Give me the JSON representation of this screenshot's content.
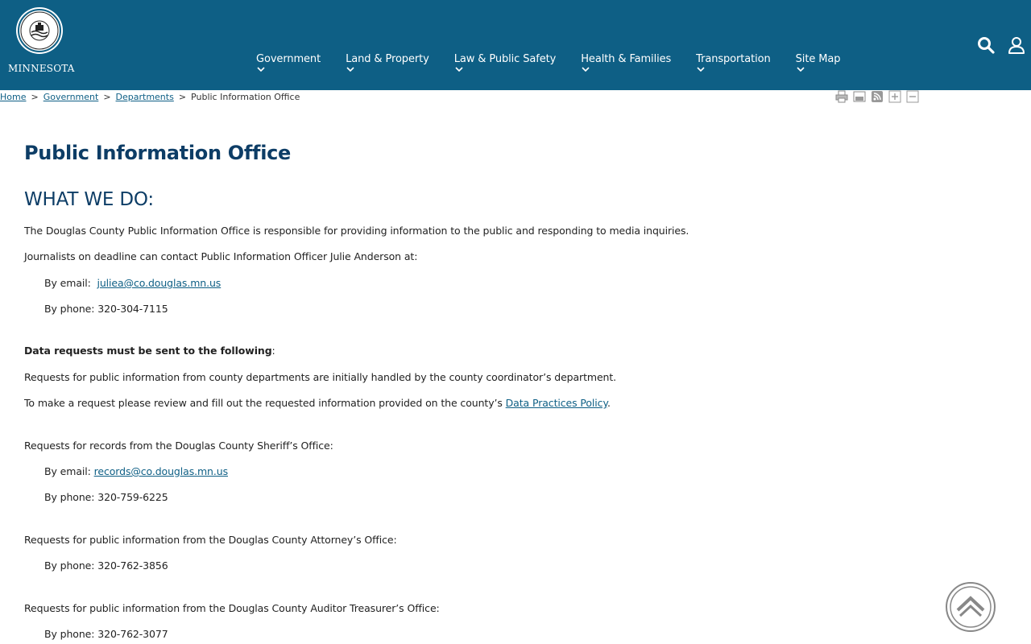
{
  "header": {
    "logo": {
      "seal_text": "DOUGLAS COUNTY",
      "state": "MINNESOTA"
    },
    "nav": [
      {
        "label": "Government"
      },
      {
        "label": "Land & Property"
      },
      {
        "label": "Law & Public Safety"
      },
      {
        "label": "Health & Families"
      },
      {
        "label": "Transportation"
      },
      {
        "label": "Site Map"
      }
    ],
    "icons": {
      "search": "search-icon",
      "account": "user-icon"
    },
    "colors": {
      "brand": "#0e5f85",
      "title": "#0d3d66"
    }
  },
  "breadcrumb": {
    "items": [
      "Home",
      "Government",
      "Departments"
    ],
    "current": "Public Information Office",
    "separator": ">"
  },
  "tools": [
    "print-icon",
    "email-icon",
    "rss-icon",
    "zoom-in-icon",
    "zoom-out-icon"
  ],
  "page": {
    "title": "Public Information Office",
    "section": "WHAT WE DO:",
    "intro": "The Douglas County Public Information Office is responsible for providing information to the public and responding to media inquiries.",
    "journalists": "Journalists on deadline can contact Public Information Officer Julie Anderson at:",
    "pio_email_label": "By email:",
    "pio_email": "juliea@co.douglas.mn.us",
    "pio_phone": "By phone: 320-304-7115",
    "data_requests_heading": "Data requests must be sent to the following",
    "data_requests_colon": ":",
    "county_requests": "Requests for public information from county departments are initially handled by the county coordinator’s department.",
    "policy_prefix": "To make a request please review and fill out the requested information provided on the county’s ",
    "policy_link": "Data Practices Policy",
    "policy_suffix": ".",
    "sheriff_requests": "Requests for records from the Douglas County Sheriff’s Office:",
    "sheriff_email_label": "By email:",
    "sheriff_email": "records@co.douglas.mn.us",
    "sheriff_phone": "By phone: 320-759-6225",
    "attorney_requests": "Requests for public information from the Douglas County Attorney’s Office:",
    "attorney_phone": "By phone: 320-762-3856",
    "auditor_requests": "Requests for public information from the Douglas County Auditor Treasurer’s Office:",
    "auditor_phone": "By phone: 320-762-3077"
  }
}
